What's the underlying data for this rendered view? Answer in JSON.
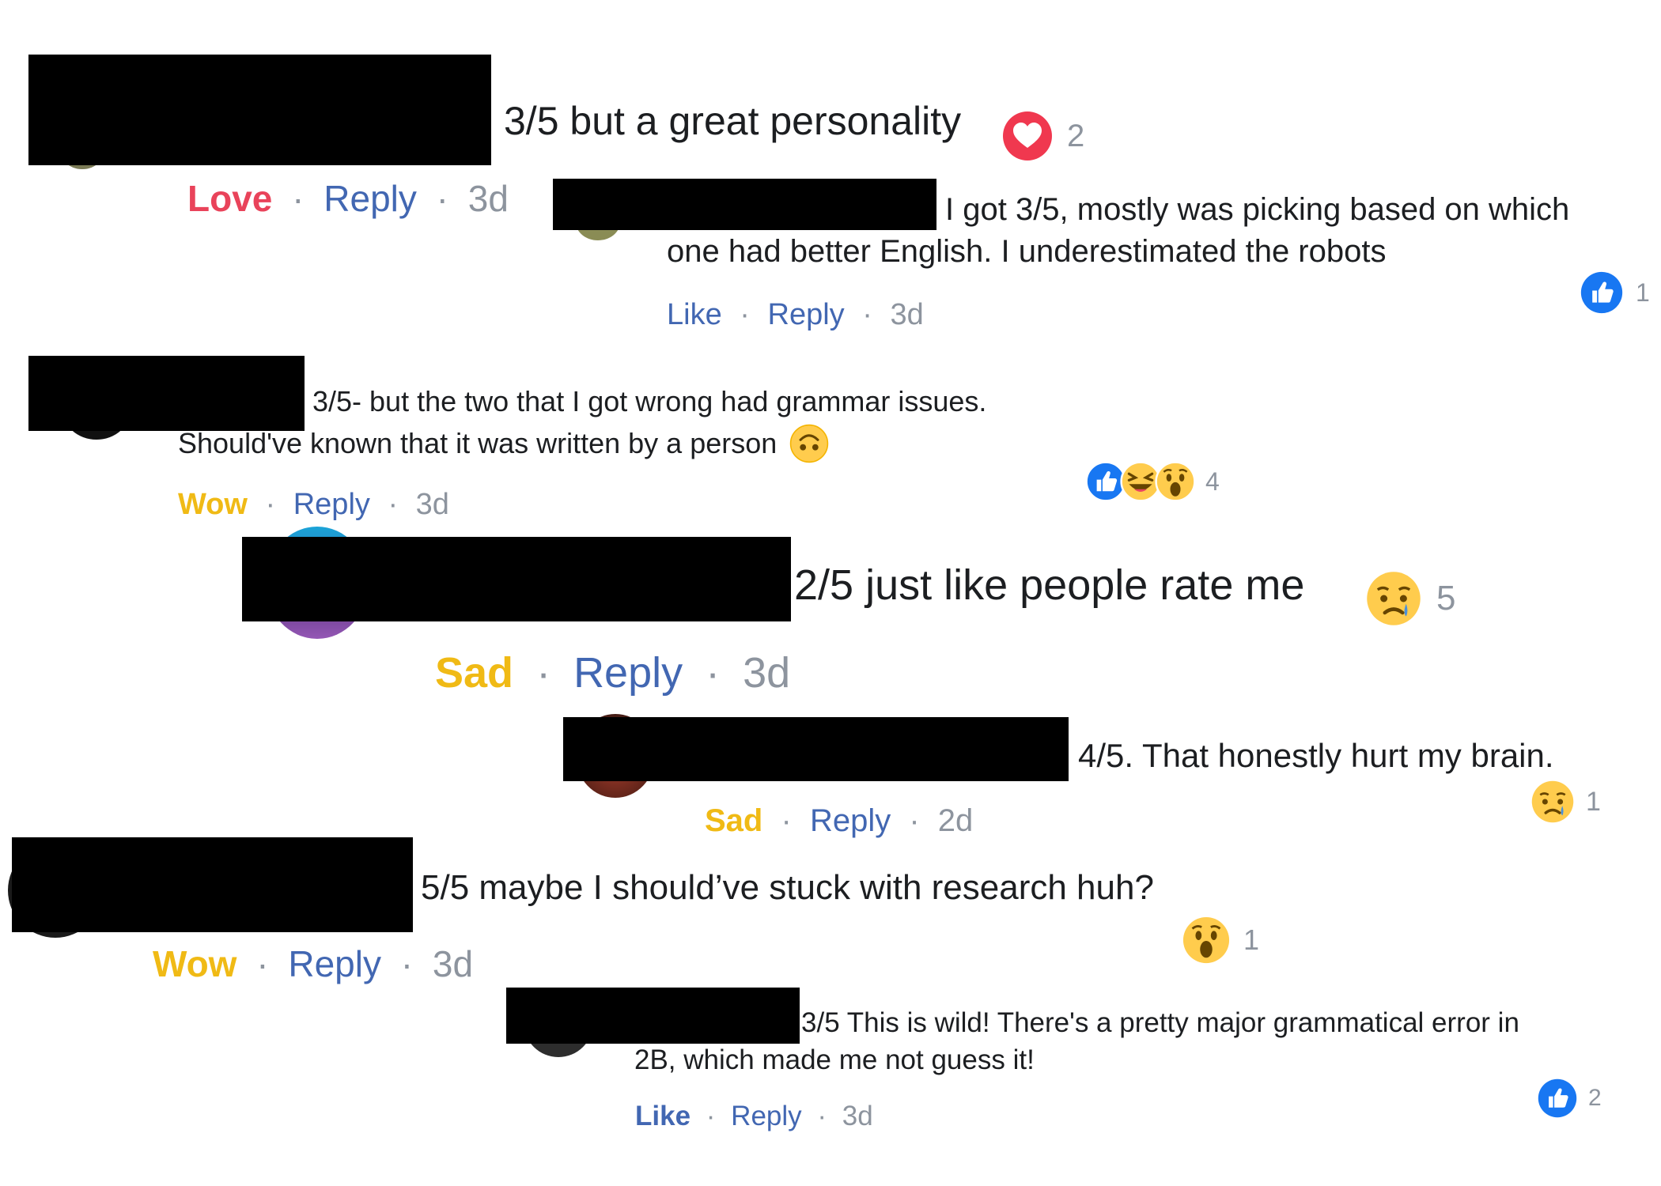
{
  "comments": [
    {
      "text": "3/5 but a great personality",
      "reaction_count": "2",
      "reaction_icons": [
        "heart-icon"
      ],
      "action": "Love",
      "reply": "Reply",
      "time": "3d"
    },
    {
      "text_line1": "I got 3/5, mostly was picking based on which",
      "text_line2": "one had better English. I underestimated the robots",
      "reaction_count": "1",
      "reaction_icons": [
        "thumbs-up-icon"
      ],
      "action": "Like",
      "reply": "Reply",
      "time": "3d"
    },
    {
      "text_line1": "3/5- but the two that I got wrong had grammar issues.",
      "text_line2": "Should've known that it was written by a person",
      "inline_emoji": "upside-down-face-icon",
      "reaction_count": "4",
      "reaction_icons": [
        "thumbs-up-icon",
        "laughing-icon",
        "wow-icon"
      ],
      "action": "Wow",
      "reply": "Reply",
      "time": "3d"
    },
    {
      "text": "2/5 just like people rate me",
      "reaction_count": "5",
      "reaction_icons": [
        "sad-icon"
      ],
      "action": "Sad",
      "reply": "Reply",
      "time": "3d"
    },
    {
      "text": "4/5. That honestly hurt my brain.",
      "reaction_count": "1",
      "reaction_icons": [
        "sad-icon"
      ],
      "action": "Sad",
      "reply": "Reply",
      "time": "2d"
    },
    {
      "text": "5/5 maybe I should’ve stuck with research huh?",
      "reaction_count": "1",
      "reaction_icons": [
        "wow-icon"
      ],
      "action": "Wow",
      "reply": "Reply",
      "time": "3d"
    },
    {
      "text_line1": "3/5 This is wild! There's a pretty major grammatical error in",
      "text_line2": "2B, which made me not guess it!",
      "reaction_count": "2",
      "reaction_icons": [
        "thumbs-up-icon"
      ],
      "action": "Like",
      "reply": "Reply",
      "time": "3d"
    }
  ],
  "separator": "·",
  "colors": {
    "love": "#e9435a",
    "wow_sad": "#f0ba15",
    "like_blue": "#4267b2",
    "muted": "#8d949e",
    "text": "#1c1e21",
    "redaction": "#000000"
  }
}
